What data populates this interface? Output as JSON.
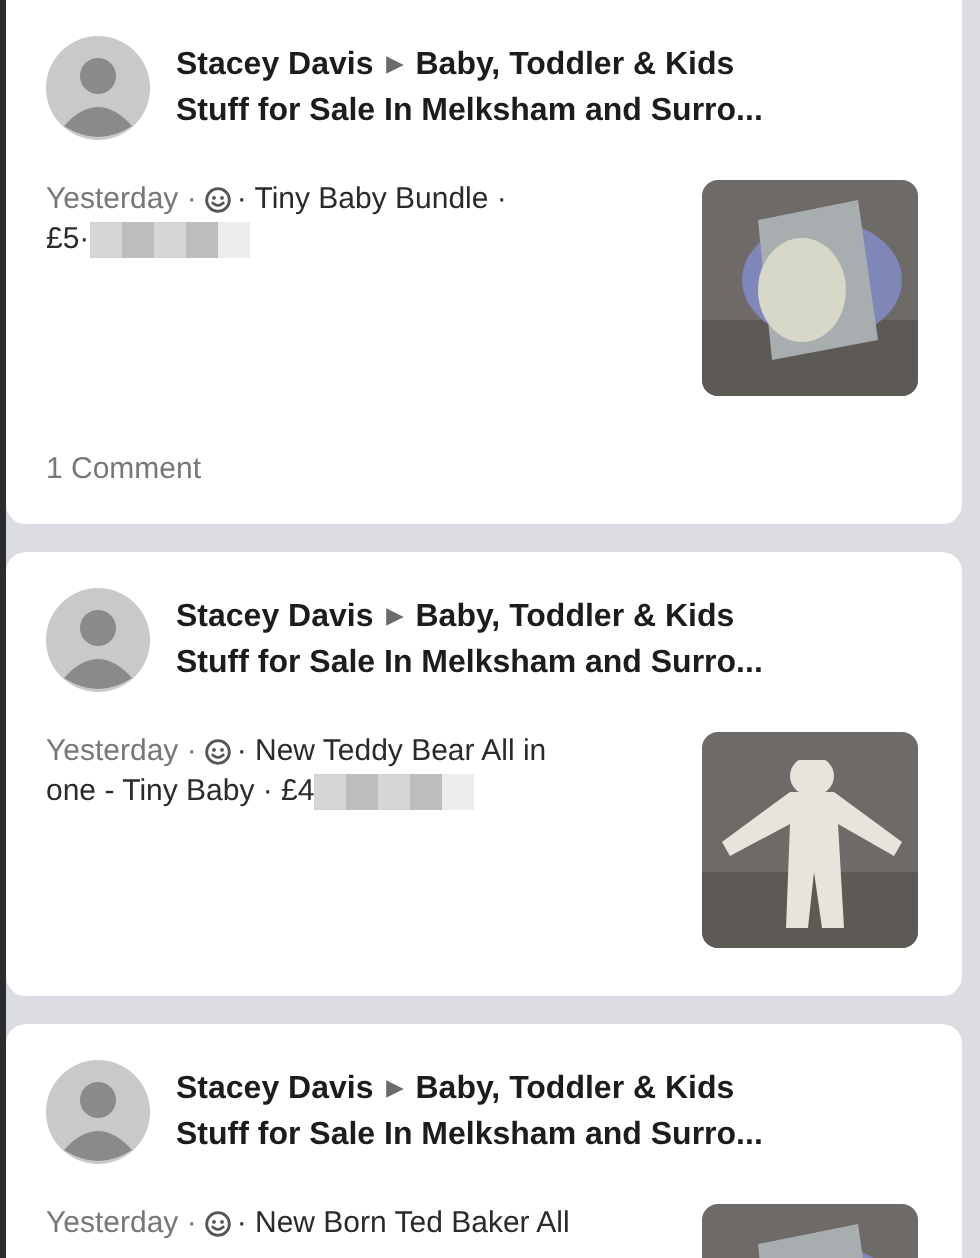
{
  "posts": [
    {
      "author": "Stacey Davis",
      "group": [
        "Baby, Toddler & Kids",
        "Stuff for Sale In Melksham and Surro..."
      ],
      "time": "Yesterday ·",
      "description": [
        "· Tiny Baby Bundle ·",
        "£5·"
      ],
      "redacted": true,
      "photo": {
        "kind": "picture"
      },
      "comments": "1 Comment"
    },
    {
      "author": "Stacey Davis",
      "group": [
        "Baby, Toddler & Kids",
        "Stuff for Sale In Melksham and Surro..."
      ],
      "time": "Yesterday ·",
      "description": [
        "· New Teddy Bear All in",
        "one - Tiny Baby · £4"
      ],
      "redacted": true,
      "photo": {
        "kind": "picture"
      }
    },
    {
      "author": "Stacey Davis",
      "group": [
        "Baby, Toddler & Kids",
        "Stuff for Sale In Melksham and Surro..."
      ],
      "time": "Yesterday ·",
      "description": [
        "· New Born Ted Baker All"
      ],
      "redacted": false,
      "photo": {
        "kind": "picture"
      }
    }
  ]
}
